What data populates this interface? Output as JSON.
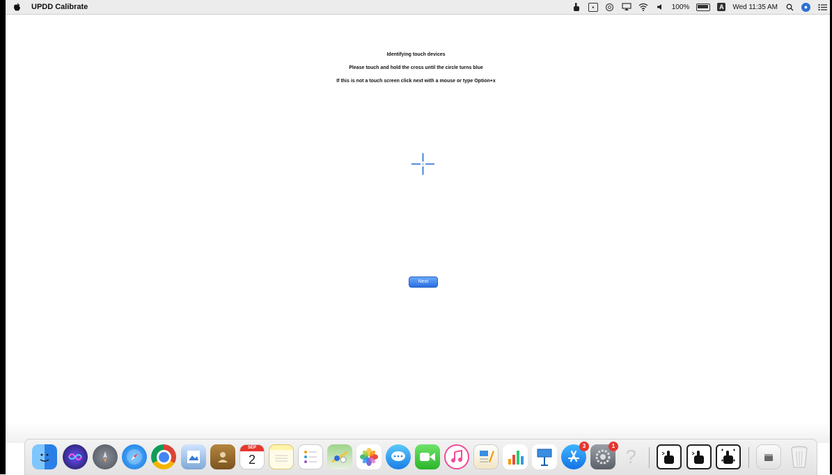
{
  "menubar": {
    "app_name": "UPDD Calibrate",
    "battery": "100%",
    "keyboard_indicator": "A",
    "datetime": "Wed 11:35 AM"
  },
  "instructions": {
    "title": "Identifying touch devices",
    "line1": "Please touch and hold the cross until  the circle turns blue",
    "line2": "If this is not a touch screen click next with a mouse or type Option+x"
  },
  "next_button": {
    "label": "Next"
  },
  "dock": {
    "calendar_month": "SEP",
    "calendar_day": "2",
    "app_store_badge": "3",
    "system_prefs_badge": "1",
    "help_glyph": "?",
    "colors": {
      "accent": "#2a6fe0",
      "badge": "#e5372e",
      "cross": "#1a64c8"
    }
  }
}
